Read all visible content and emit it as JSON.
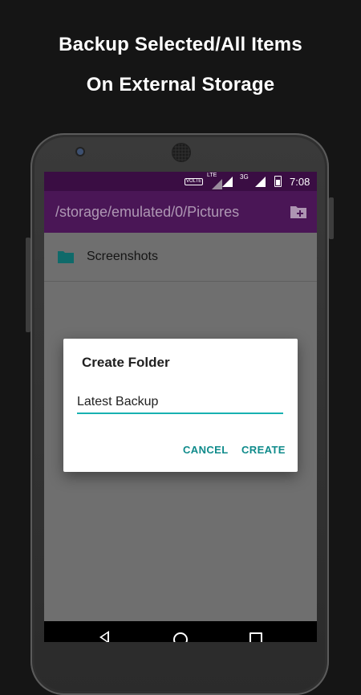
{
  "promo": {
    "line1": "Backup Selected/All Items",
    "line2": "On External Storage"
  },
  "status_bar": {
    "volte": "VOLTE",
    "network": "3G",
    "time": "7:08"
  },
  "toolbar": {
    "path": "/storage/emulated/0/Pictures",
    "add_folder_icon": "create-folder-icon"
  },
  "list": {
    "items": [
      {
        "label": "Screenshots",
        "icon": "folder-icon"
      }
    ]
  },
  "dialog": {
    "title": "Create Folder",
    "input_value": "Latest Backup",
    "cancel_label": "CANCEL",
    "create_label": "CREATE"
  },
  "fab": {
    "icon": "clipboard-paste-icon"
  },
  "nav": {
    "back_icon": "back-icon",
    "home_icon": "home-icon",
    "recent_icon": "recent-apps-icon"
  },
  "colors": {
    "toolbar": "#4a1656",
    "status_bar": "#3a0d43",
    "accent": "#137a7a",
    "folder": "#0f6a6a"
  }
}
